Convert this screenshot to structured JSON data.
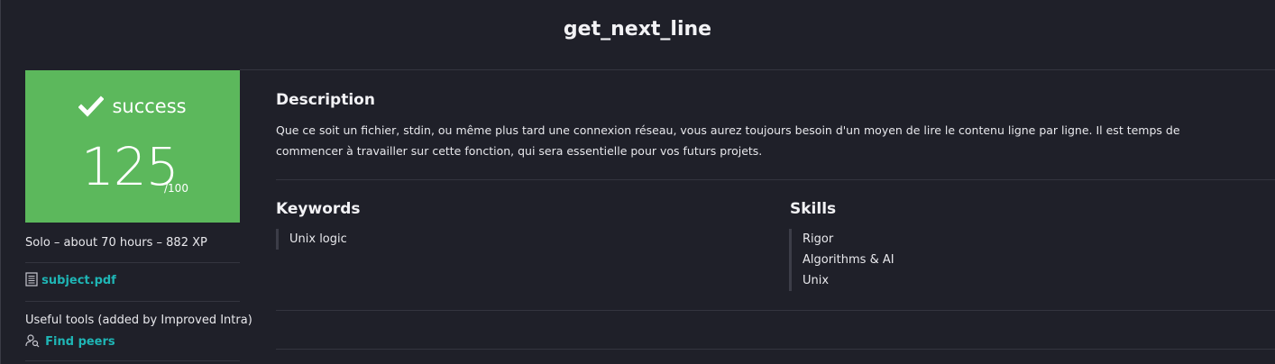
{
  "project": {
    "title": "get_next_line"
  },
  "result": {
    "status_icon": "check-icon",
    "status": "success",
    "score": "125",
    "max": "/100",
    "color": "#5cb85c"
  },
  "meta": "Solo – about 70 hours – 882 XP",
  "subject": {
    "icon": "document-icon",
    "label": "subject.pdf"
  },
  "tools": {
    "heading": "Useful tools (added by Improved Intra)",
    "find_peers_icon": "user-search-icon",
    "find_peers": "Find peers"
  },
  "description": {
    "title": "Description",
    "text": "Que ce soit un fichier, stdin, ou même plus tard une connexion réseau, vous aurez toujours besoin d'un moyen de lire le contenu ligne par ligne. Il est temps de commencer à travailler sur cette fonction, qui sera essentielle pour vos futurs projets."
  },
  "keywords": {
    "title": "Keywords",
    "items": [
      "Unix logic"
    ]
  },
  "skills": {
    "title": "Skills",
    "items": [
      "Rigor",
      "Algorithms & AI",
      "Unix"
    ]
  },
  "colors": {
    "background": "#1f2029",
    "link": "#1fb5b5"
  }
}
